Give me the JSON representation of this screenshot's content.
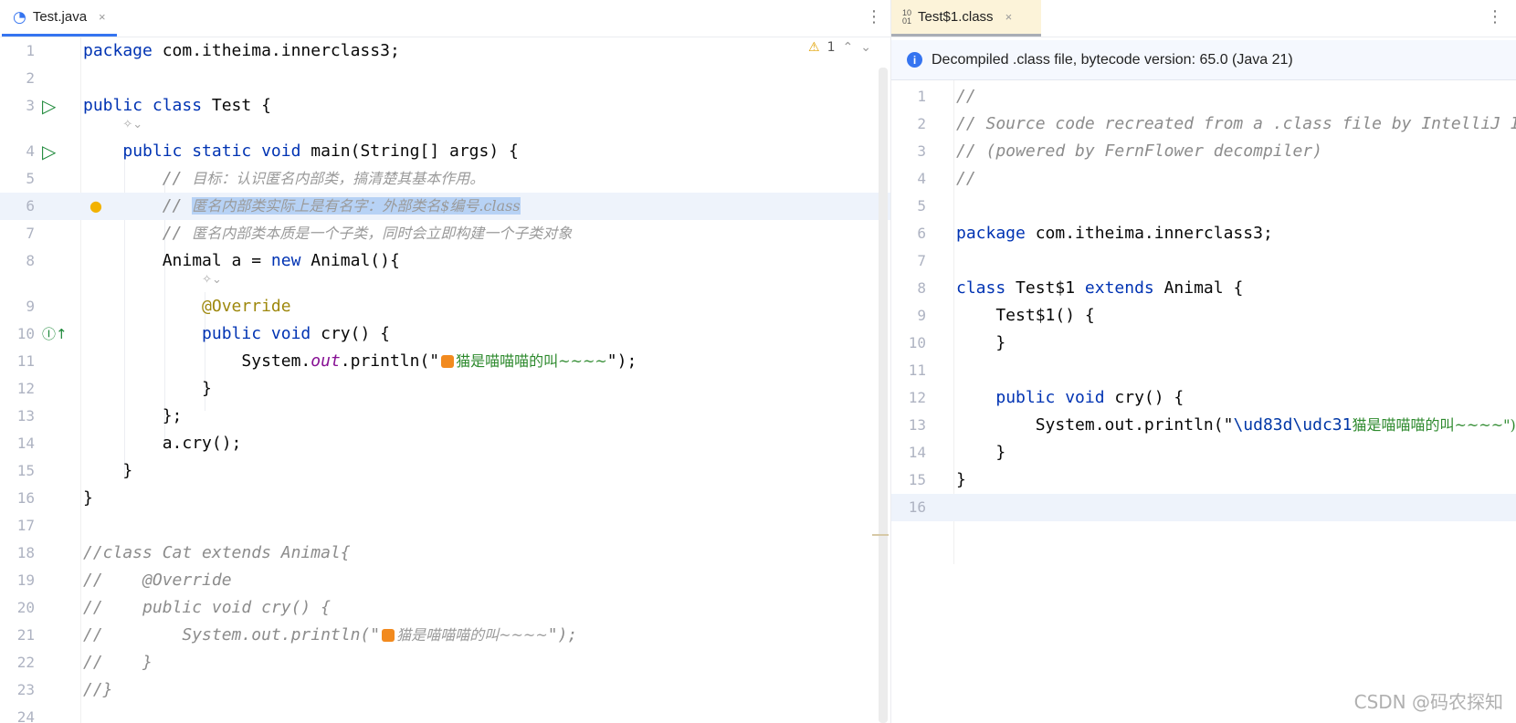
{
  "left": {
    "tab": {
      "label": "Test.java",
      "icon": "java-class-icon",
      "close": "×",
      "accent": "#3574f0"
    },
    "inspection": {
      "warning_count": "1",
      "up": "⌃",
      "down": "⌄"
    },
    "lines": [
      {
        "n": "1",
        "t": [
          [
            "package",
            "kw"
          ],
          [
            " com.itheima.innerclass3;",
            ""
          ]
        ]
      },
      {
        "n": "2",
        "t": []
      },
      {
        "n": "3",
        "t": [
          [
            "public class",
            "kw"
          ],
          [
            " Test {",
            ""
          ]
        ],
        "gutter": "run"
      },
      {
        "hint": true
      },
      {
        "n": "4",
        "t": [
          [
            "    "
          ],
          [
            "public static void",
            "kw"
          ],
          [
            " main(String[] args) {",
            ""
          ]
        ],
        "gutter": "run"
      },
      {
        "n": "5",
        "t": [
          [
            "        "
          ],
          [
            "// ",
            "cm"
          ],
          [
            "目标：认识匿名内部类，搞清楚其基本作用。",
            "cmz"
          ]
        ]
      },
      {
        "n": "6",
        "t": [
          [
            "        "
          ],
          [
            "// ",
            "cm"
          ],
          [
            "匿名内部类实际上是有名字：外部类名$编号.class",
            "cmz sel"
          ]
        ],
        "gutter": "bulb",
        "hl": true
      },
      {
        "n": "7",
        "t": [
          [
            "        "
          ],
          [
            "// ",
            "cm"
          ],
          [
            "匿名内部类本质是一个子类，同时会立即构建一个子类对象",
            "cmz"
          ]
        ]
      },
      {
        "n": "8",
        "t": [
          [
            "        Animal a = ",
            ""
          ],
          [
            "new",
            "kw"
          ],
          [
            " Animal(){",
            ""
          ]
        ]
      },
      {
        "hint": true,
        "indent": 12
      },
      {
        "n": "9",
        "t": [
          [
            "            "
          ],
          [
            "@Override",
            "an"
          ]
        ]
      },
      {
        "n": "10",
        "t": [
          [
            "            "
          ],
          [
            "public void",
            "kw"
          ],
          [
            " cry() {",
            ""
          ]
        ],
        "gutter": "override"
      },
      {
        "n": "11",
        "t": [
          [
            "                System.",
            ""
          ],
          [
            "out",
            "it"
          ],
          [
            ".println(\"",
            ""
          ],
          [
            "CAT",
            "str"
          ],
          [
            "猫是喵喵喵的叫~~~~",
            "strz"
          ],
          [
            "\");",
            ""
          ]
        ]
      },
      {
        "n": "12",
        "t": [
          [
            "            }",
            ""
          ]
        ]
      },
      {
        "n": "13",
        "t": [
          [
            "        };",
            ""
          ]
        ]
      },
      {
        "n": "14",
        "t": [
          [
            "        a.cry();",
            ""
          ]
        ]
      },
      {
        "n": "15",
        "t": [
          [
            "    }",
            ""
          ]
        ]
      },
      {
        "n": "16",
        "t": [
          [
            "}",
            ""
          ]
        ]
      },
      {
        "n": "17",
        "t": []
      },
      {
        "n": "18",
        "t": [
          [
            "//class Cat extends Animal{",
            "cm"
          ]
        ]
      },
      {
        "n": "19",
        "t": [
          [
            "//    @Override",
            "cm"
          ]
        ]
      },
      {
        "n": "20",
        "t": [
          [
            "//    public void cry() {",
            "cm"
          ]
        ]
      },
      {
        "n": "21",
        "t": [
          [
            "//        System.out.println(\"",
            "cm"
          ],
          [
            "CAT",
            "cm"
          ],
          [
            "猫是喵喵喵的叫~~~~",
            "cmz"
          ],
          [
            "\");",
            "cm"
          ]
        ]
      },
      {
        "n": "22",
        "t": [
          [
            "//    }",
            "cm"
          ]
        ]
      },
      {
        "n": "23",
        "t": [
          [
            "//}",
            "cm"
          ]
        ]
      },
      {
        "n": "24",
        "t": []
      }
    ]
  },
  "right": {
    "tab": {
      "label": "Test$1.class",
      "icon": "binary-class-icon",
      "close": "×",
      "bg": "#fcf3d9"
    },
    "banner": {
      "icon": "info-icon",
      "text": "Decompiled .class file, bytecode version: 65.0 (Java 21)"
    },
    "lines": [
      {
        "n": "1",
        "t": [
          [
            "//",
            "cm"
          ]
        ]
      },
      {
        "n": "2",
        "t": [
          [
            "// Source code recreated from a .class file by IntelliJ IDEA",
            "cm"
          ]
        ]
      },
      {
        "n": "3",
        "t": [
          [
            "// (powered by FernFlower decompiler)",
            "cm"
          ]
        ]
      },
      {
        "n": "4",
        "t": [
          [
            "//",
            "cm"
          ]
        ]
      },
      {
        "n": "5",
        "t": []
      },
      {
        "n": "6",
        "t": [
          [
            "package",
            "kw"
          ],
          [
            " com.itheima.innerclass3;",
            ""
          ]
        ]
      },
      {
        "n": "7",
        "t": []
      },
      {
        "n": "8",
        "t": [
          [
            "class",
            "kw"
          ],
          [
            " Test$1 ",
            ""
          ],
          [
            "extends",
            "kw"
          ],
          [
            " Animal {",
            ""
          ]
        ]
      },
      {
        "n": "9",
        "t": [
          [
            "    Test$1() {",
            ""
          ]
        ]
      },
      {
        "n": "10",
        "t": [
          [
            "    }",
            ""
          ]
        ]
      },
      {
        "n": "11",
        "t": []
      },
      {
        "n": "12",
        "t": [
          [
            "    "
          ],
          [
            "public void",
            "kw"
          ],
          [
            " cry() {",
            ""
          ]
        ]
      },
      {
        "n": "13",
        "t": [
          [
            "        System.out.println(\"",
            ""
          ],
          [
            "\\ud83d\\udc31",
            "esc"
          ],
          [
            "猫是喵喵喵的叫~~~~\");",
            "strz"
          ]
        ]
      },
      {
        "n": "14",
        "t": [
          [
            "    }",
            ""
          ]
        ]
      },
      {
        "n": "15",
        "t": [
          [
            "}",
            ""
          ]
        ]
      },
      {
        "n": "16",
        "t": [],
        "hl": true
      }
    ]
  },
  "watermark": "CSDN @码农探知"
}
